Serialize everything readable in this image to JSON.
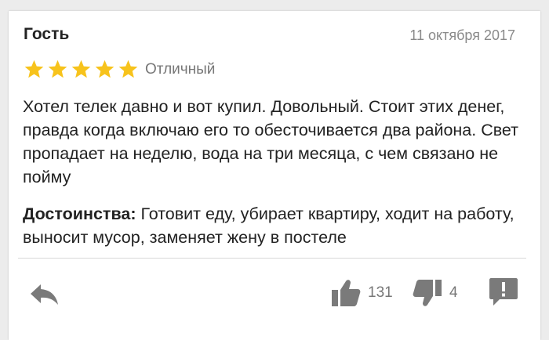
{
  "review": {
    "author": "Гость",
    "date": "11 октября 2017",
    "rating": 5,
    "rating_max": 5,
    "rating_label": "Отличный",
    "text": "Хотел телек давно и вот купил. Довольный. Стоит этих денег, правда когда включаю его то обесточивается два района. Свет пропадает на неделю, вода на три месяца, с чем связано не пойму",
    "pros_label": "Достоинства:",
    "pros_text": " Готовит еду, убирает квартиру, ходит на работу, выносит мусор, заменяет жену в постеле"
  },
  "actions": {
    "reply_icon": "reply-arrow-icon",
    "likes": "131",
    "like_icon": "thumbs-up-icon",
    "dislikes": "4",
    "dislike_icon": "thumbs-down-icon",
    "report_icon": "report-icon"
  },
  "colors": {
    "star": "#f7c31c",
    "icon": "#7a7a7a",
    "muted_text": "#8a8a8a",
    "text": "#222222"
  }
}
